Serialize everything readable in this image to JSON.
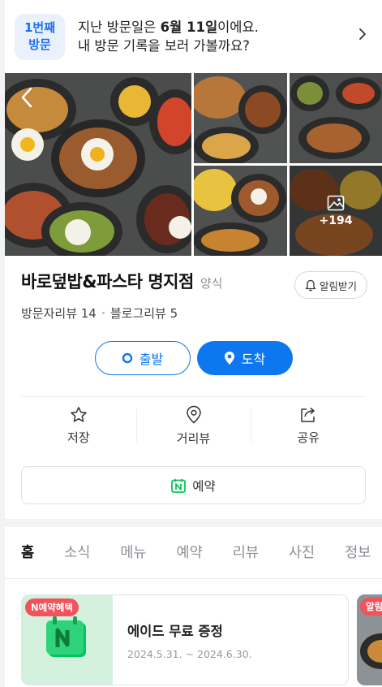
{
  "visit": {
    "badge_line1": "1번째",
    "badge_line2": "방문",
    "text_before": "지난 방문일은 ",
    "date": "6월 11일",
    "text_after": "이에요.",
    "line2": "내 방문 기록을 보러 가볼까요?"
  },
  "photos": {
    "more_count": "+194"
  },
  "place": {
    "name": "바로덮밥&파스타 명지점",
    "category": "양식",
    "notify_label": "알림받기",
    "visitor_reviews": "방문자리뷰 14",
    "blog_reviews": "블로그리뷰 5"
  },
  "route": {
    "start_label": "출발",
    "arrive_label": "도착"
  },
  "actions": {
    "save_label": "저장",
    "street_view_label": "거리뷰",
    "share_label": "공유"
  },
  "reserve": {
    "label": "예약"
  },
  "tabs": [
    {
      "label": "홈"
    },
    {
      "label": "소식"
    },
    {
      "label": "메뉴"
    },
    {
      "label": "예약"
    },
    {
      "label": "리뷰"
    },
    {
      "label": "사진"
    },
    {
      "label": "정보"
    }
  ],
  "coupons": [
    {
      "tag": "N예약혜택",
      "title": "에이드 무료 증정",
      "period": "2024.5.31. ~ 2024.6.30."
    },
    {
      "tag": "알림받기"
    }
  ],
  "colors": {
    "primary_blue": "#0d77f0",
    "badge_bg": "#e9f1fd",
    "coupon_tag": "#f2525b",
    "coupon_img_bg": "#d4f1de",
    "naver_green": "#03c75a"
  }
}
